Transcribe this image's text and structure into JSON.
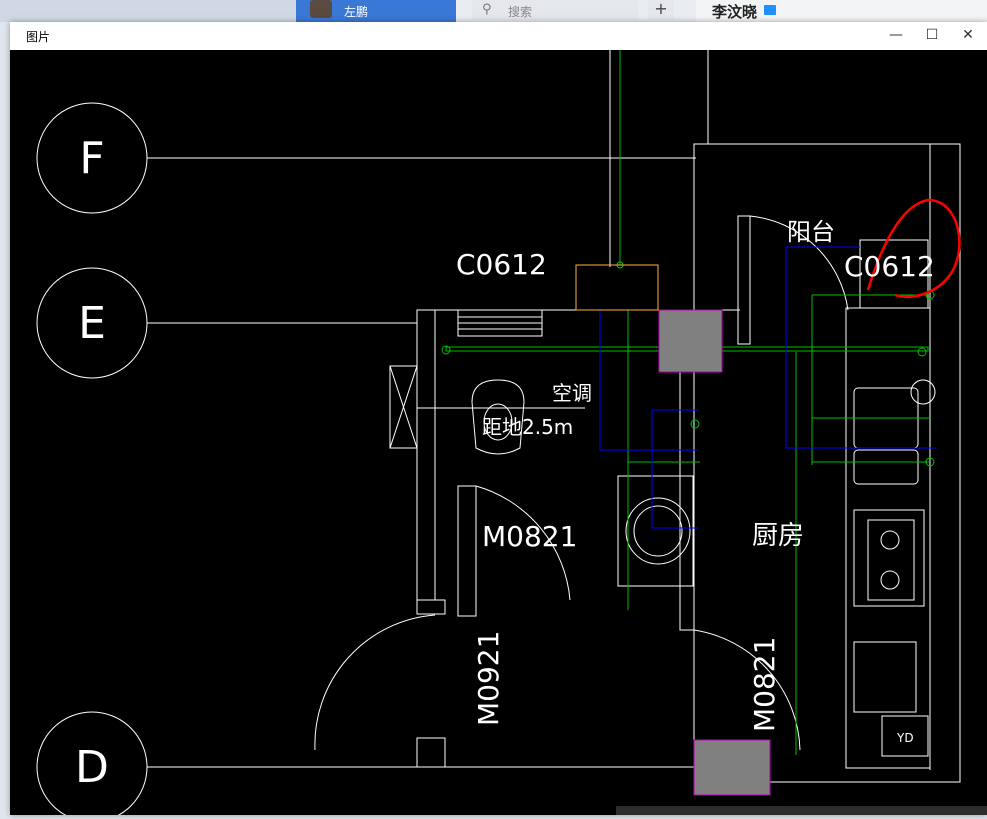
{
  "taskbar": {
    "active_chat_name": "左鹏",
    "search_placeholder": "搜索",
    "add_label": "+",
    "contact_name": "李汶晓"
  },
  "window": {
    "title": "图片",
    "minimize_label": "—",
    "maximize_label": "☐",
    "close_label": "✕"
  },
  "drawing": {
    "axes": [
      "F",
      "E",
      "D"
    ],
    "labels": {
      "balcony": "阳台",
      "window_c0612_left": "C0612",
      "window_c0612_right": "C0612",
      "air_conditioner": "空调",
      "distance": "距地2.5m",
      "door_m0821_bath": "M0821",
      "door_m0921": "M0921",
      "door_m0821_kitchen": "M0821",
      "kitchen": "厨房",
      "yd": "YD"
    },
    "colors": {
      "background": "#000000",
      "wall": "#ffffff",
      "pipe_green": "#00c000",
      "pipe_blue": "#0000ff",
      "column_fill": "#808080",
      "column_border": "#c000c0",
      "annotation_red": "#ff0000",
      "window_orange": "#ffb040"
    }
  }
}
